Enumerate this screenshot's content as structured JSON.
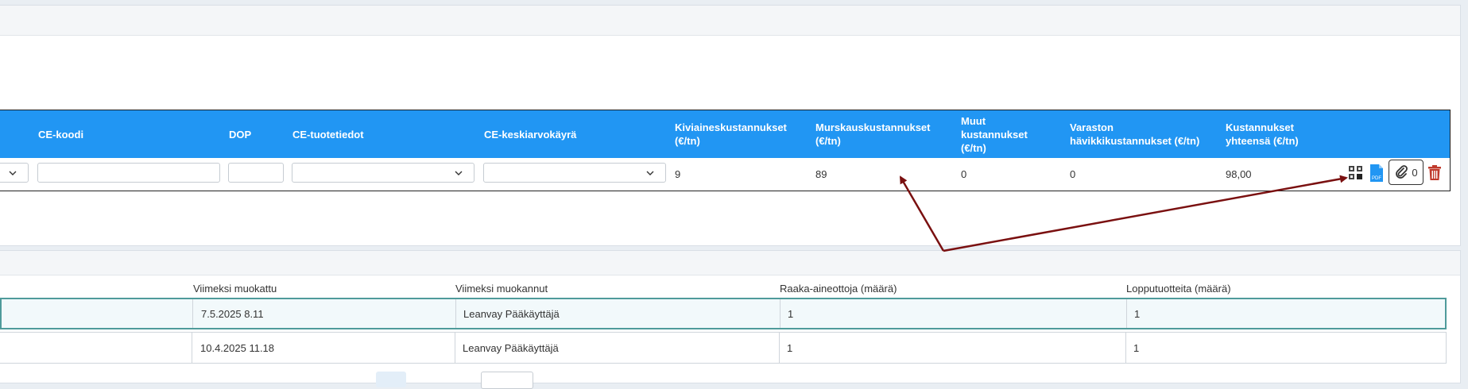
{
  "grid": {
    "headers": {
      "ce_code": "CE-koodi",
      "dop": "DOP",
      "ce_product": "CE-tuotetiedot",
      "ce_curve": "CE-keskiarvokäyrä",
      "aggregate_cost": "Kiviaineskustannukset (€/tn)",
      "crushing_cost": "Murskauskustannukset (€/tn)",
      "other_cost": "Muut kustannukset (€/tn)",
      "storage_loss": "Varaston hävikkikustannukset (€/tn)",
      "total_cost": "Kustannukset yhteensä (€/tn)"
    },
    "row": {
      "ce_code_value": "",
      "dop_value": "",
      "ce_product_value": "",
      "ce_curve_value": "",
      "aggregate_cost": "9",
      "crushing_cost": "89",
      "other_cost": "0",
      "storage_loss": "0",
      "total_cost": "98,00",
      "attachment_count": "0"
    },
    "icons": [
      "qr-code-icon",
      "pdf-icon",
      "paperclip-icon",
      "trash-icon"
    ]
  },
  "table": {
    "columns": [
      "Viimeksi muokattu",
      "Viimeksi muokannut",
      "Raaka-aineottoja (määrä)",
      "Lopputuotteita (määrä)"
    ],
    "rows": [
      {
        "modified": "7.5.2025 8.11",
        "modified_by": "Leanvay Pääkäyttäjä",
        "raw_count": "1",
        "product_count": "1"
      },
      {
        "modified": "10.4.2025 11.18",
        "modified_by": "Leanvay Pääkäyttäjä",
        "raw_count": "1",
        "product_count": "1"
      }
    ]
  },
  "colors": {
    "header_blue": "#2196f3",
    "annotation_arrow": "#7a1010",
    "delete_red": "#c0392b",
    "selected_row_border": "#4f9b9b"
  }
}
